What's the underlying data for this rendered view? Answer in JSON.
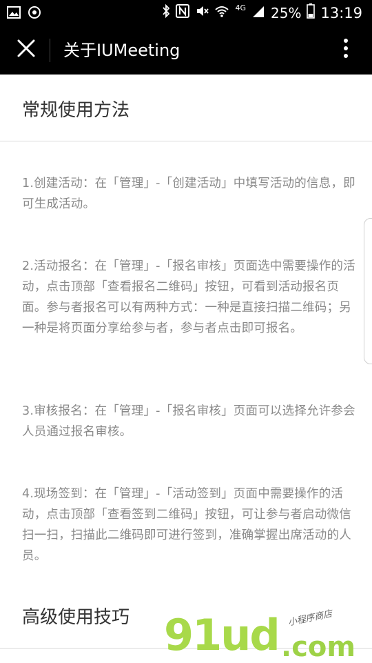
{
  "status_bar": {
    "left_icons": [
      "image-icon",
      "sync-icon"
    ],
    "right_icons": [
      "bluetooth-icon",
      "nfc-icon",
      "mute-icon",
      "wifi-icon",
      "signal-icon",
      "battery-icon"
    ],
    "network": "4G",
    "battery": "25%",
    "time": "13:19"
  },
  "navbar": {
    "title": "关于IUMeeting",
    "close_icon": "close-icon",
    "more_icon": "more-vertical-icon"
  },
  "sections": [
    {
      "title": "常规使用方法"
    },
    {
      "title": "高级使用技巧"
    }
  ],
  "paragraphs": [
    "1.创建活动：在「管理」-「创建活动」中填写活动的信息，即可生成活动。",
    "2.活动报名：在「管理」-「报名审核」页面选中需要操作的活动，点击顶部「查看报名二维码」按钮，可看到活动报名页面。参与者报名可以有两种方式：一种是直接扫描二维码；另一种是将页面分享给参与者，参与者点击即可报名。",
    "3.审核报名：在「管理」-「报名审核」页面可以选择允许参会人员通过报名审核。",
    "4.现场签到：在「管理」-「活动签到」页面中需要操作的活动，点击顶部「查看签到二维码」按钮，可让参与者启动微信扫一扫，扫描此二维码即可进行签到，准确掌握出席活动的人员。"
  ],
  "watermark": {
    "main": "91ud",
    "domain": ".com",
    "subtitle": "小程序商店"
  },
  "colors": {
    "bar_bg": "#000000",
    "body_text": "#8a8a8a",
    "title_text": "#333333",
    "watermark_green": "#a8d94a"
  }
}
